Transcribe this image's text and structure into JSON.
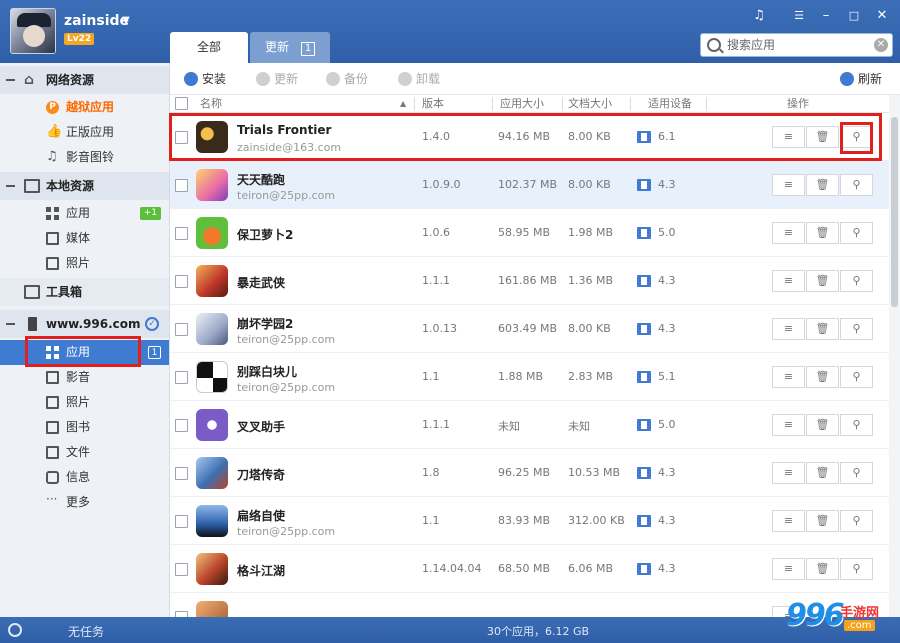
{
  "user": {
    "name": "zainside",
    "level": "Lv22"
  },
  "tabs": {
    "all": "全部",
    "update": "更新",
    "update_count": "1"
  },
  "search": {
    "placeholder": "搜索应用"
  },
  "sidebar": {
    "net_resources": "网络资源",
    "jailbreak_apps": "越狱应用",
    "licensed_apps": "正版应用",
    "media_library": "影音图铃",
    "local_resources": "本地资源",
    "local_apps": "应用",
    "local_apps_badge": "+1",
    "local_media": "媒体",
    "local_photos": "照片",
    "toolbox": "工具箱",
    "device_name": "www.996.com",
    "device_apps": "应用",
    "device_apps_badge": "1",
    "device_video": "影音",
    "device_photos": "照片",
    "device_books": "图书",
    "device_files": "文件",
    "device_messages": "信息",
    "device_more": "更多"
  },
  "toolbar": {
    "install": "安装",
    "update": "更新",
    "backup": "备份",
    "uninstall": "卸载",
    "refresh": "刷新"
  },
  "columns": {
    "name": "名称",
    "version": "版本",
    "app_size": "应用大小",
    "doc_size": "文档大小",
    "device": "适用设备",
    "ops": "操作"
  },
  "apps": [
    {
      "name": "Trials Frontier",
      "account": "zainside@163.com",
      "version": "1.4.0",
      "app_size": "94.16 MB",
      "doc_size": "8.00 KB",
      "device": "6.1",
      "icon_color": "#3a2a1a"
    },
    {
      "name": "天天酷跑",
      "account": "teiron@25pp.com",
      "version": "1.0.9.0",
      "app_size": "102.37 MB",
      "doc_size": "8.00 KB",
      "device": "4.3",
      "icon_color": "#e86aa8"
    },
    {
      "name": "保卫萝卜2",
      "account": "",
      "version": "1.0.6",
      "app_size": "58.95 MB",
      "doc_size": "1.98 MB",
      "device": "5.0",
      "icon_color": "#5fbf3a"
    },
    {
      "name": "暴走武侠",
      "account": "",
      "version": "1.1.1",
      "app_size": "161.86 MB",
      "doc_size": "1.36 MB",
      "device": "4.3",
      "icon_color": "#c0392b"
    },
    {
      "name": "崩坏学园2",
      "account": "teiron@25pp.com",
      "version": "1.0.13",
      "app_size": "603.49 MB",
      "doc_size": "8.00 KB",
      "device": "4.3",
      "icon_color": "#9aa8c8"
    },
    {
      "name": "别踩白块儿",
      "account": "teiron@25pp.com",
      "version": "1.1",
      "app_size": "1.88 MB",
      "doc_size": "2.83 MB",
      "device": "5.1",
      "icon_color": "#111111"
    },
    {
      "name": "叉叉助手",
      "account": "",
      "version": "1.1.1",
      "app_size": "未知",
      "doc_size": "未知",
      "device": "5.0",
      "icon_color": "#7b5cc6"
    },
    {
      "name": "刀塔传奇",
      "account": "",
      "version": "1.8",
      "app_size": "96.25 MB",
      "doc_size": "10.53 MB",
      "device": "4.3",
      "icon_color": "#3d6fb0"
    },
    {
      "name": "扁络自使",
      "account": "teiron@25pp.com",
      "version": "1.1",
      "app_size": "83.93 MB",
      "doc_size": "312.00 KB",
      "device": "4.3",
      "icon_color": "#2c5fa8"
    },
    {
      "name": "格斗江湖",
      "account": "",
      "version": "1.14.04.04",
      "app_size": "68.50 MB",
      "doc_size": "6.06 MB",
      "device": "4.3",
      "icon_color": "#b8432a"
    },
    {
      "name": "",
      "account": "",
      "version": "",
      "app_size": "",
      "doc_size": "",
      "device": "",
      "icon_color": "#a0522d"
    }
  ],
  "status": {
    "task": "无任务",
    "summary": "30个应用，6.12 GB"
  },
  "watermark": {
    "num": "996",
    "text": "手游网",
    "com": ".com"
  },
  "colors": {
    "accent": "#3e7bd1",
    "highlight": "#e0201c",
    "orange": "#ff6a00"
  }
}
